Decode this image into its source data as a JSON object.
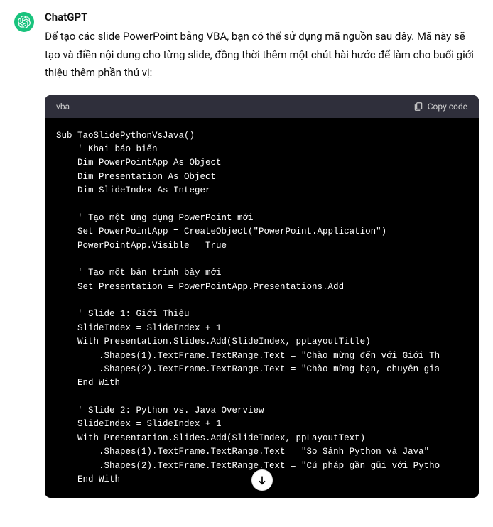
{
  "assistant": {
    "name": "ChatGPT",
    "message": "Để tạo các slide PowerPoint bằng VBA, bạn có thể sử dụng mã nguồn sau đây. Mã này sẽ tạo và điền nội dung cho từng slide, đồng thời thêm một chút hài hước để làm cho buổi giới thiệu thêm phần thú vị:"
  },
  "code": {
    "language": "vba",
    "copy_label": "Copy code",
    "content": "Sub TaoSlidePythonVsJava()\n    ' Khai báo biến\n    Dim PowerPointApp As Object\n    Dim Presentation As Object\n    Dim SlideIndex As Integer\n\n    ' Tạo một ứng dụng PowerPoint mới\n    Set PowerPointApp = CreateObject(\"PowerPoint.Application\")\n    PowerPointApp.Visible = True\n\n    ' Tạo một bản trình bày mới\n    Set Presentation = PowerPointApp.Presentations.Add\n\n    ' Slide 1: Giới Thiệu\n    SlideIndex = SlideIndex + 1\n    With Presentation.Slides.Add(SlideIndex, ppLayoutTitle)\n        .Shapes(1).TextFrame.TextRange.Text = \"Chào mừng đến với Giới Th\n        .Shapes(2).TextFrame.TextRange.Text = \"Chào mừng bạn, chuyên gia\n    End With\n\n    ' Slide 2: Python vs. Java Overview\n    SlideIndex = SlideIndex + 1\n    With Presentation.Slides.Add(SlideIndex, ppLayoutText)\n        .Shapes(1).TextFrame.TextRange.Text = \"So Sánh Python và Java\" \n        .Shapes(2).TextFrame.TextRange.Text = \"Cú pháp gần gũi với Pytho\n    End With"
  }
}
